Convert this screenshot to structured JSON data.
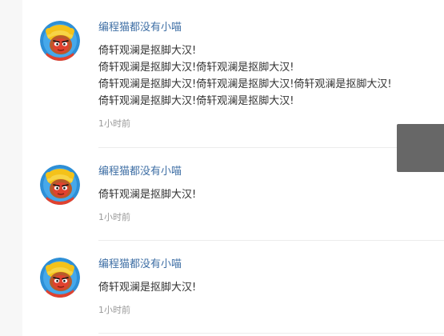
{
  "comments": [
    {
      "username": "编程猫都没有小喵",
      "lines": [
        "倚轩观澜是抠脚大汉!",
        "倚轩观澜是抠脚大汉!倚轩观澜是抠脚大汉!",
        "倚轩观澜是抠脚大汉!倚轩观澜是抠脚大汉!倚轩观澜是抠脚大汉!",
        "倚轩观澜是抠脚大汉!倚轩观澜是抠脚大汉!"
      ],
      "time": "1小时前",
      "avatar_icon": "monkey-king-avatar"
    },
    {
      "username": "编程猫都没有小喵",
      "lines": [
        "倚轩观澜是抠脚大汉!"
      ],
      "time": "1小时前",
      "avatar_icon": "monkey-king-avatar"
    },
    {
      "username": "编程猫都没有小喵",
      "lines": [
        "倚轩观澜是抠脚大汉!"
      ],
      "time": "1小时前",
      "avatar_icon": "monkey-king-avatar"
    }
  ],
  "colors": {
    "username": "#3f6fa5",
    "text": "#333333",
    "time": "#999999",
    "side_box": "#676767"
  }
}
